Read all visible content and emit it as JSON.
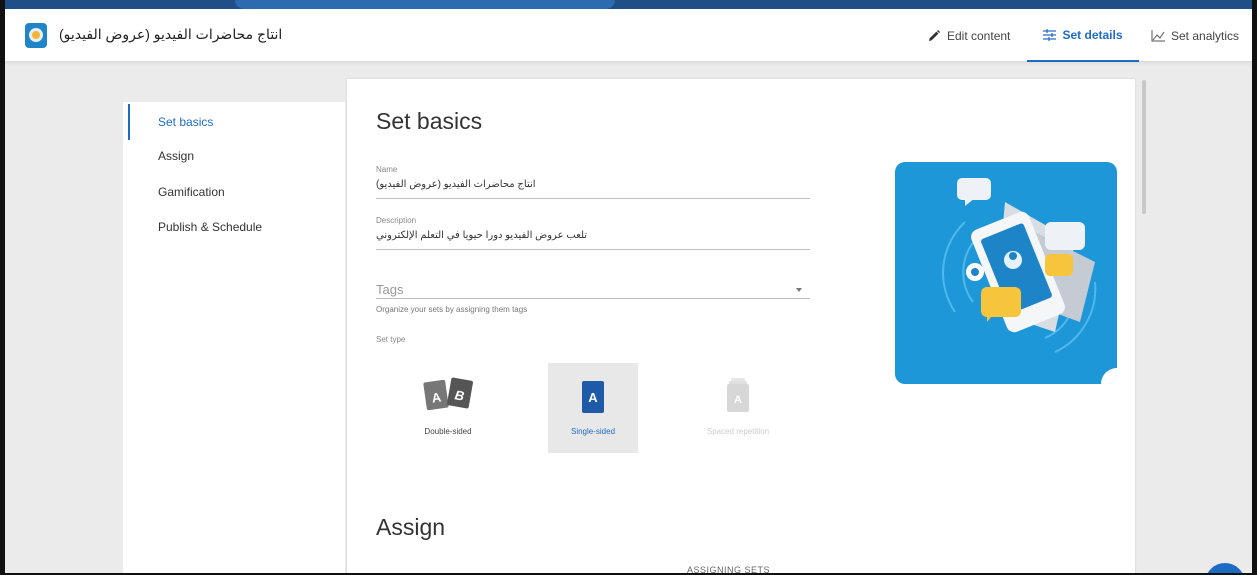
{
  "app": {
    "set_title": "انتاج محاضرات الفيديو (عروض الفيديو)"
  },
  "tabs": [
    {
      "label": "Edit content",
      "icon": "pencil-icon",
      "active": false
    },
    {
      "label": "Set details",
      "icon": "sliders-icon",
      "active": true
    },
    {
      "label": "Set analytics",
      "icon": "analytics-icon",
      "active": false
    }
  ],
  "sidebar": {
    "items": [
      {
        "label": "Set basics",
        "active": true
      },
      {
        "label": "Assign",
        "active": false
      },
      {
        "label": "Gamification",
        "active": false
      },
      {
        "label": "Publish & Schedule",
        "active": false
      }
    ]
  },
  "main": {
    "heading": "Set basics",
    "name": {
      "label": "Name",
      "value": "انتاج محاضرات الفيديو (عروض الفيديو)"
    },
    "description": {
      "label": "Description",
      "value": "تلعب عروض الفيديو دورا حيويا في التعلم الإلكتروني"
    },
    "tags": {
      "placeholder": "Tags",
      "hint": "Organize your sets by assigning them tags"
    },
    "set_type": {
      "label": "Set type",
      "options": [
        {
          "label": "Double-sided",
          "icon": "double-sided-card-icon",
          "selected": false,
          "disabled": false
        },
        {
          "label": "Single-sided",
          "icon": "single-sided-card-icon",
          "selected": true,
          "disabled": false
        },
        {
          "label": "Spaced repetition",
          "icon": "spaced-repetition-card-icon",
          "selected": false,
          "disabled": true
        }
      ]
    },
    "assign_heading": "Assign",
    "assigning_sets_label": "ASSIGNING SETS"
  },
  "colors": {
    "accent": "#1e6bc4",
    "hero_bg": "#1e97d9",
    "page_bg": "#ebebeb"
  }
}
